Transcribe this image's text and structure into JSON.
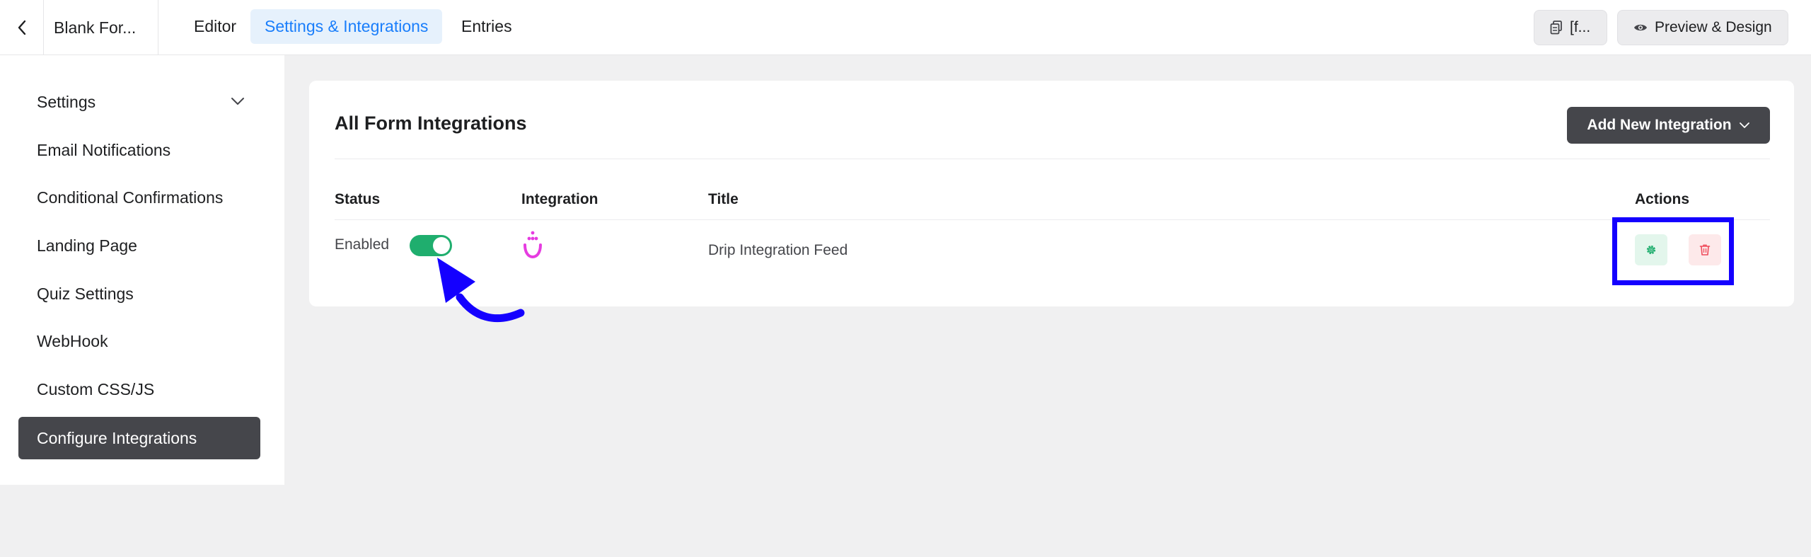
{
  "topbar": {
    "form_name": "Blank For...",
    "tabs": [
      {
        "label": "Editor",
        "active": false
      },
      {
        "label": "Settings & Integrations",
        "active": true
      },
      {
        "label": "Entries",
        "active": false
      }
    ],
    "shortcode_label": "[f...",
    "preview_label": "Preview & Design"
  },
  "sidebar": {
    "items": [
      {
        "label": "Settings",
        "has_chevron": true
      },
      {
        "label": "Email Notifications"
      },
      {
        "label": "Conditional Confirmations"
      },
      {
        "label": "Landing Page"
      },
      {
        "label": "Quiz Settings"
      },
      {
        "label": "WebHook"
      },
      {
        "label": "Custom CSS/JS"
      },
      {
        "label": "Configure Integrations",
        "active": true
      }
    ]
  },
  "main": {
    "title": "All Form Integrations",
    "add_button_label": "Add New Integration",
    "columns": [
      "Status",
      "Integration",
      "Title",
      "Actions"
    ],
    "rows": [
      {
        "status": "Enabled",
        "enabled": true,
        "integration_icon": "drip-icon",
        "title": "Drip Integration Feed"
      }
    ]
  },
  "colors": {
    "accent": "#1a7efb",
    "dark_button": "#45464b",
    "toggle_on": "#1fae6e",
    "annotation": "#1400ff",
    "drip_brand": "#e63ce0",
    "settings_green": "#1fae6e",
    "delete_red": "#ef4a5a"
  },
  "icons": {
    "back": "chevron-left-icon",
    "shortcode": "copy-icon",
    "preview": "eye-icon",
    "sidebar_settings": "chevron-down-icon",
    "add_dropdown": "chevron-down-icon",
    "action_settings": "gear-icon",
    "action_delete": "trash-icon"
  }
}
